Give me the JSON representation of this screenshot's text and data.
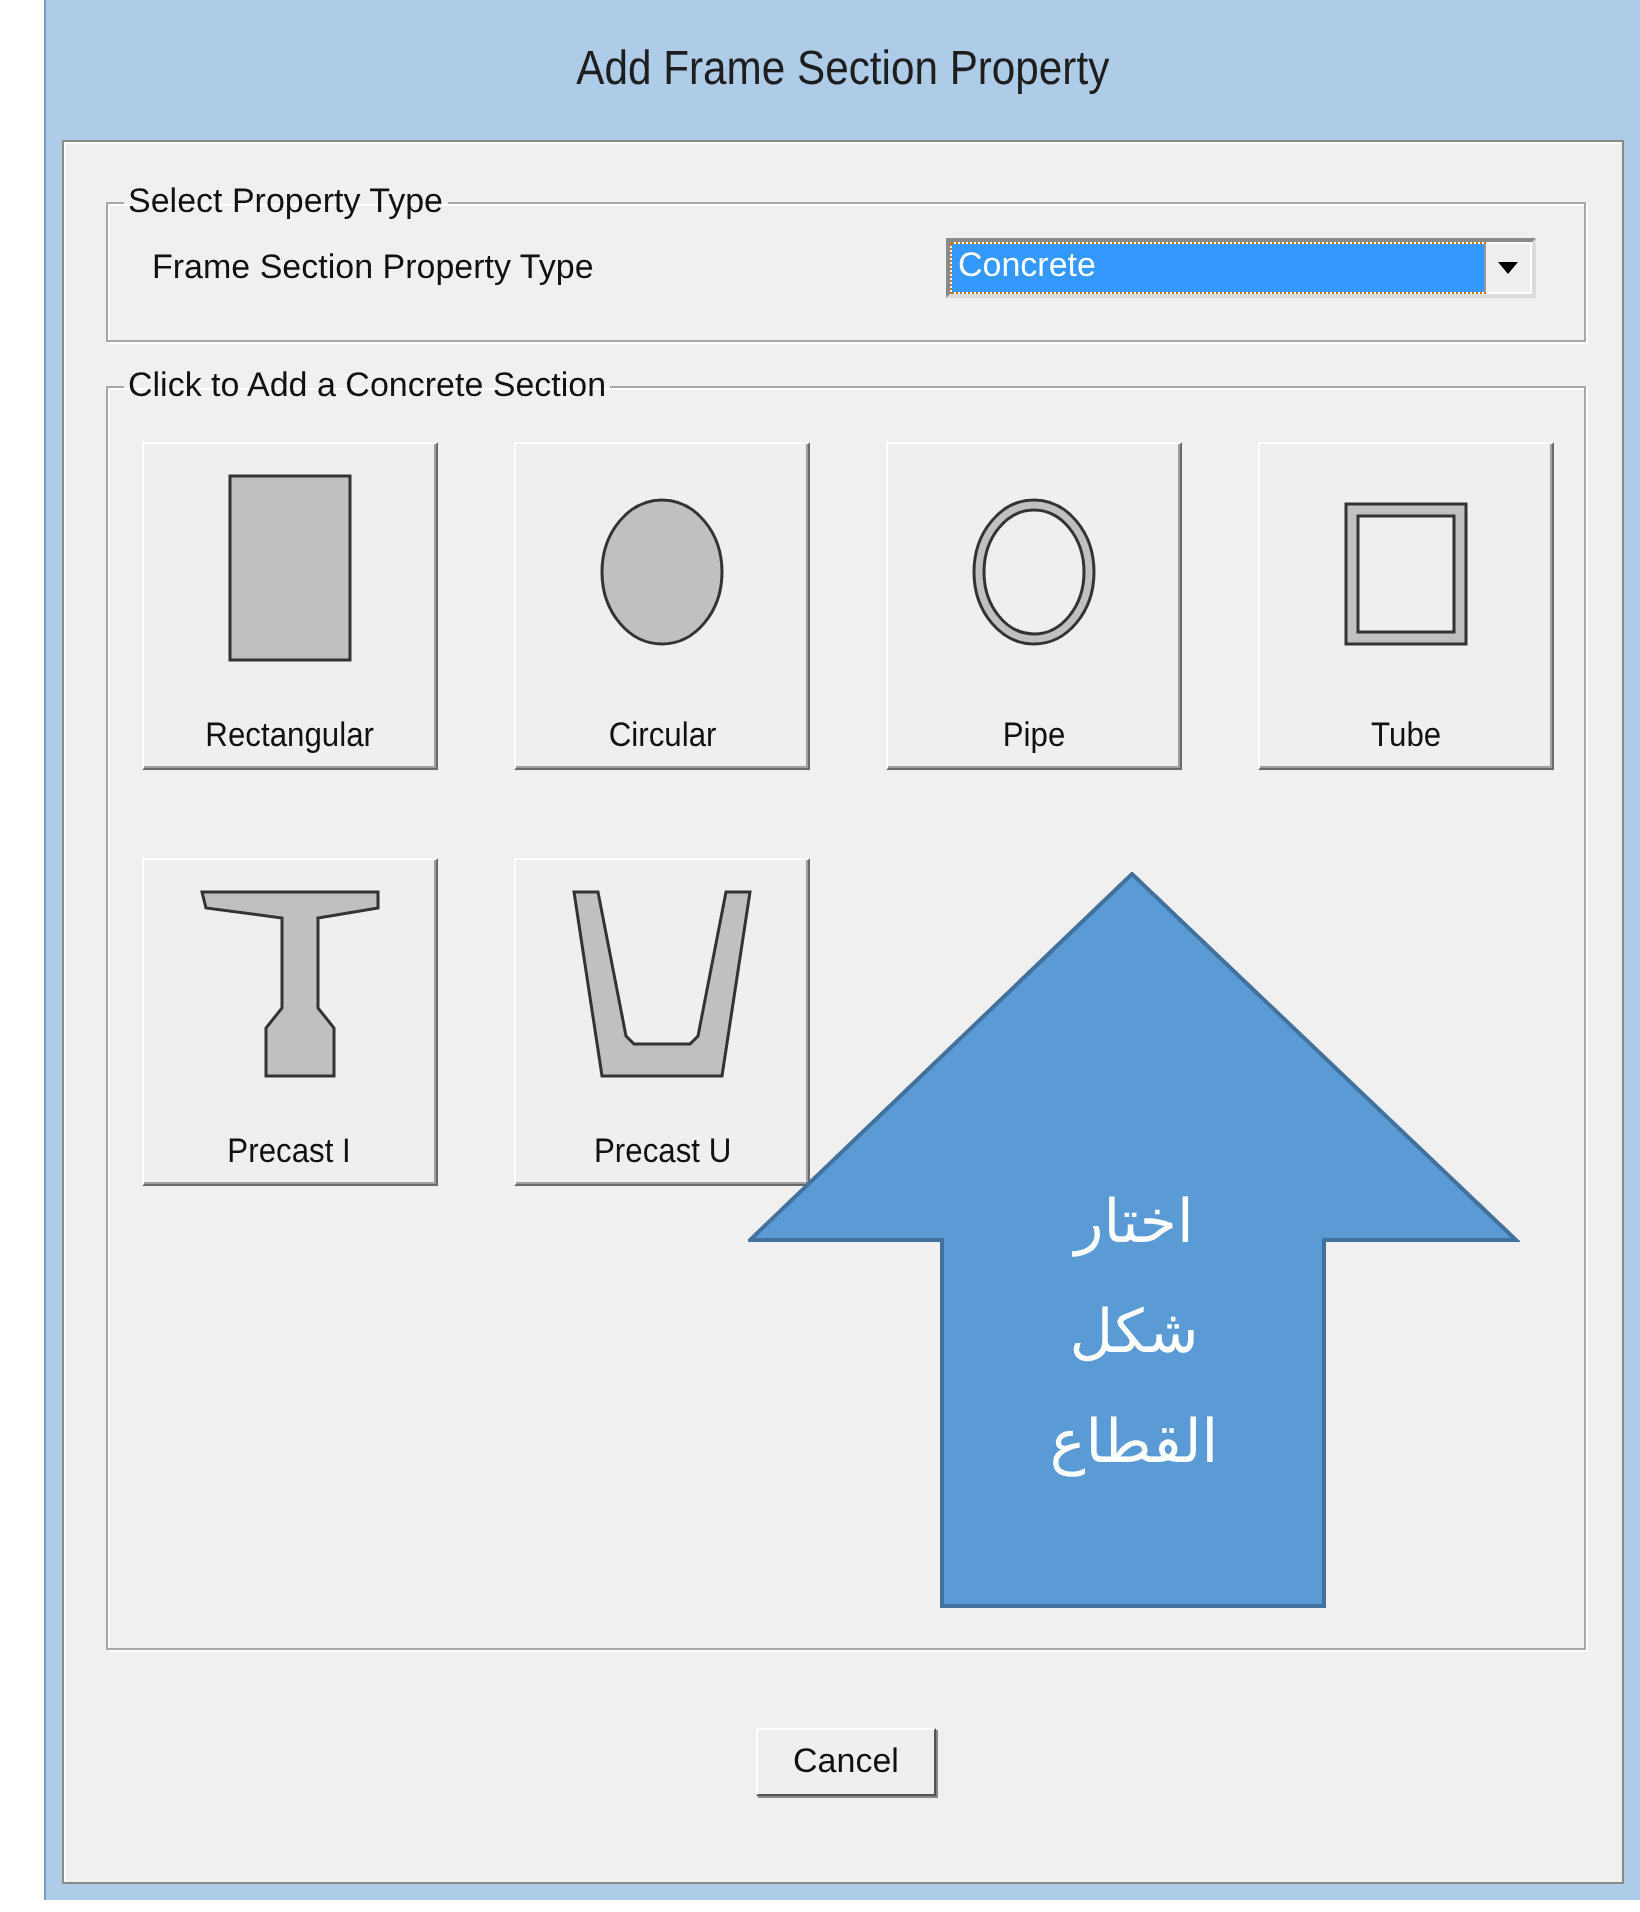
{
  "window": {
    "title": "Add Frame Section Property"
  },
  "property_group": {
    "title": "Select Property Type",
    "field_label": "Frame Section Property Type",
    "dropdown": {
      "value": "Concrete",
      "focused": true
    }
  },
  "section_group": {
    "title": "Click to Add a Concrete Section",
    "sections": [
      {
        "kind": "rectangular",
        "label": "Rectangular"
      },
      {
        "kind": "circular",
        "label": "Circular"
      },
      {
        "kind": "pipe",
        "label": "Pipe"
      },
      {
        "kind": "tube",
        "label": "Tube"
      },
      {
        "kind": "precast_i",
        "label": "Precast I"
      },
      {
        "kind": "precast_u",
        "label": "Precast U"
      }
    ]
  },
  "buttons": [
    {
      "label": "Cancel"
    }
  ],
  "callout": {
    "text": "اختار شكل القطاع",
    "color": "#5b9bd5"
  }
}
